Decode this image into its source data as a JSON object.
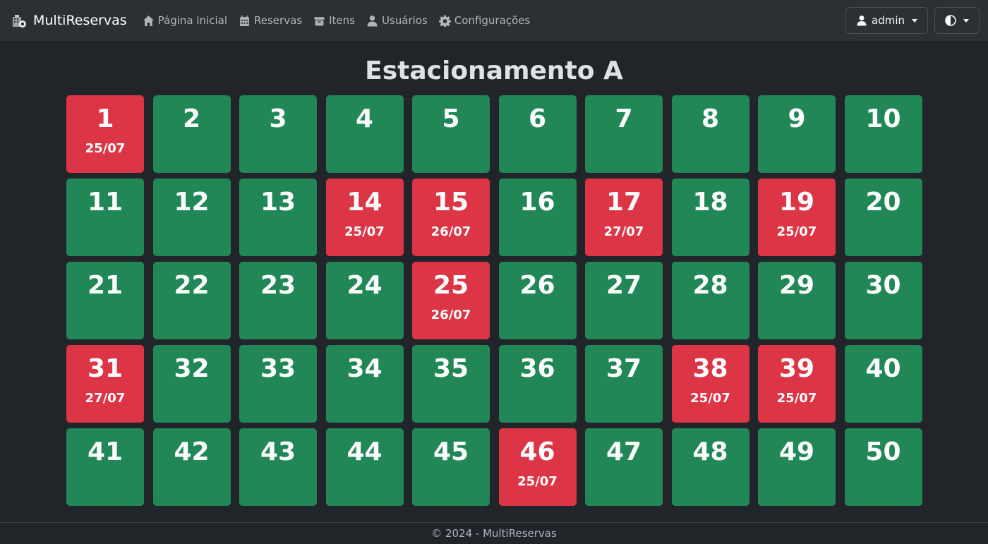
{
  "brand": {
    "name": "MultiReservas",
    "logo_icon": "building-icon"
  },
  "nav": {
    "items": [
      {
        "label": "Página inicial",
        "icon": "home-icon"
      },
      {
        "label": "Reservas",
        "icon": "calendar-icon"
      },
      {
        "label": "Itens",
        "icon": "box-icon"
      },
      {
        "label": "Usuários",
        "icon": "user-icon"
      },
      {
        "label": "Configurações",
        "icon": "gear-icon"
      }
    ],
    "user_menu": {
      "label": "admin",
      "icon": "user-icon"
    },
    "theme_toggle": {
      "icon": "contrast-icon"
    }
  },
  "main": {
    "title": "Estacionamento A"
  },
  "colors": {
    "free": "#218756",
    "busy": "#dc3545",
    "background": "#212529",
    "navbar": "#2b3035"
  },
  "slots": [
    {
      "number": "1",
      "status": "busy",
      "date": "25/07"
    },
    {
      "number": "2",
      "status": "free",
      "date": ""
    },
    {
      "number": "3",
      "status": "free",
      "date": ""
    },
    {
      "number": "4",
      "status": "free",
      "date": ""
    },
    {
      "number": "5",
      "status": "free",
      "date": ""
    },
    {
      "number": "6",
      "status": "free",
      "date": ""
    },
    {
      "number": "7",
      "status": "free",
      "date": ""
    },
    {
      "number": "8",
      "status": "free",
      "date": ""
    },
    {
      "number": "9",
      "status": "free",
      "date": ""
    },
    {
      "number": "10",
      "status": "free",
      "date": ""
    },
    {
      "number": "11",
      "status": "free",
      "date": ""
    },
    {
      "number": "12",
      "status": "free",
      "date": ""
    },
    {
      "number": "13",
      "status": "free",
      "date": ""
    },
    {
      "number": "14",
      "status": "busy",
      "date": "25/07"
    },
    {
      "number": "15",
      "status": "busy",
      "date": "26/07"
    },
    {
      "number": "16",
      "status": "free",
      "date": ""
    },
    {
      "number": "17",
      "status": "busy",
      "date": "27/07"
    },
    {
      "number": "18",
      "status": "free",
      "date": ""
    },
    {
      "number": "19",
      "status": "busy",
      "date": "25/07"
    },
    {
      "number": "20",
      "status": "free",
      "date": ""
    },
    {
      "number": "21",
      "status": "free",
      "date": ""
    },
    {
      "number": "22",
      "status": "free",
      "date": ""
    },
    {
      "number": "23",
      "status": "free",
      "date": ""
    },
    {
      "number": "24",
      "status": "free",
      "date": ""
    },
    {
      "number": "25",
      "status": "busy",
      "date": "26/07"
    },
    {
      "number": "26",
      "status": "free",
      "date": ""
    },
    {
      "number": "27",
      "status": "free",
      "date": ""
    },
    {
      "number": "28",
      "status": "free",
      "date": ""
    },
    {
      "number": "29",
      "status": "free",
      "date": ""
    },
    {
      "number": "30",
      "status": "free",
      "date": ""
    },
    {
      "number": "31",
      "status": "busy",
      "date": "27/07"
    },
    {
      "number": "32",
      "status": "free",
      "date": ""
    },
    {
      "number": "33",
      "status": "free",
      "date": ""
    },
    {
      "number": "34",
      "status": "free",
      "date": ""
    },
    {
      "number": "35",
      "status": "free",
      "date": ""
    },
    {
      "number": "36",
      "status": "free",
      "date": ""
    },
    {
      "number": "37",
      "status": "free",
      "date": ""
    },
    {
      "number": "38",
      "status": "busy",
      "date": "25/07"
    },
    {
      "number": "39",
      "status": "busy",
      "date": "25/07"
    },
    {
      "number": "40",
      "status": "free",
      "date": ""
    },
    {
      "number": "41",
      "status": "free",
      "date": ""
    },
    {
      "number": "42",
      "status": "free",
      "date": ""
    },
    {
      "number": "43",
      "status": "free",
      "date": ""
    },
    {
      "number": "44",
      "status": "free",
      "date": ""
    },
    {
      "number": "45",
      "status": "free",
      "date": ""
    },
    {
      "number": "46",
      "status": "busy",
      "date": "25/07"
    },
    {
      "number": "47",
      "status": "free",
      "date": ""
    },
    {
      "number": "48",
      "status": "free",
      "date": ""
    },
    {
      "number": "49",
      "status": "free",
      "date": ""
    },
    {
      "number": "50",
      "status": "free",
      "date": ""
    }
  ],
  "footer": {
    "text": "© 2024 - MultiReservas"
  }
}
